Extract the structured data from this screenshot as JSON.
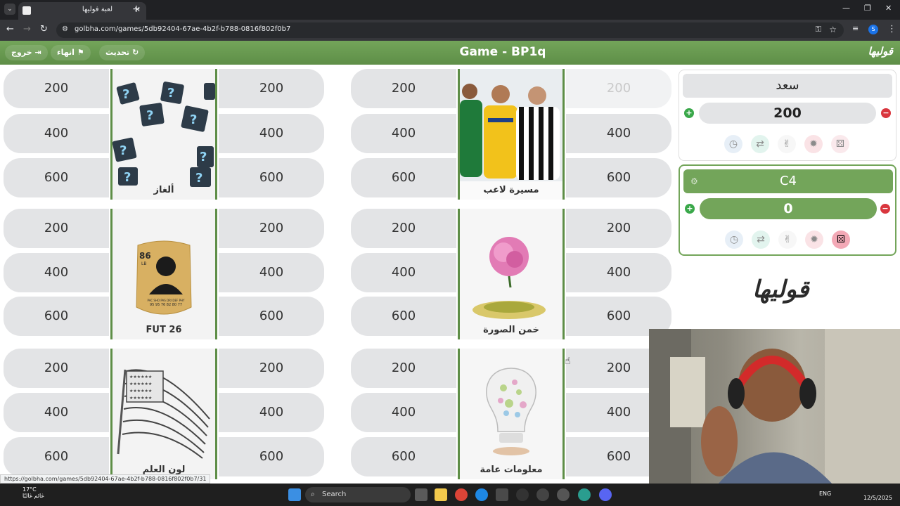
{
  "browser": {
    "tab_title": "لعبة فوليها",
    "url": "golbha.com/games/5db92404-67ae-4b2f-b788-0816f802f0b7",
    "status_url": "https://golbha.com/games/5db92404-67ae-4b2f-b788-0816f802f0b7/31",
    "profile_initial": "S"
  },
  "header": {
    "exit_label": "خروج",
    "end_label": "انهاء",
    "refresh_label": "تحديث",
    "title": "Game - BP1q",
    "logo": "قوليها"
  },
  "board": {
    "categories": [
      {
        "name": "ألغاز",
        "left": [
          "200",
          "400",
          "600"
        ],
        "right": [
          "200",
          "400",
          "600"
        ]
      },
      {
        "name": "مسيرة لاعب",
        "left": [
          "200",
          "400",
          "600"
        ],
        "right": [
          "200",
          "400",
          "600"
        ]
      },
      {
        "name": "FUT 26",
        "left": [
          "200",
          "400",
          "600"
        ],
        "right": [
          "200",
          "400",
          "600"
        ]
      },
      {
        "name": "خمن الصورة",
        "left": [
          "200",
          "400",
          "600"
        ],
        "right": [
          "200",
          "400",
          "600"
        ]
      },
      {
        "name": "لون العلم",
        "left": [
          "200",
          "400",
          "600"
        ],
        "right": [
          "200",
          "400",
          "600"
        ]
      },
      {
        "name": "معلومات عامة",
        "left": [
          "200",
          "400",
          "600"
        ],
        "right": [
          "200",
          "400",
          "600"
        ]
      }
    ],
    "fut_card": {
      "rating": "86",
      "position": "LB",
      "stats": "95 95 76 82 80 77",
      "stat_labels": "PAC SHO PAS DRI DEF PHY"
    }
  },
  "teams": [
    {
      "name": "سعد",
      "score": "200",
      "active": false
    },
    {
      "name": "C4",
      "score": "0",
      "active": true
    }
  ],
  "side_logo": "قوليها",
  "taskbar": {
    "temp": "17°C",
    "weather_label": "غائم غالبًا",
    "search_label": "Search",
    "lang": "ENG",
    "date": "12/5/2025"
  },
  "colors": {
    "brand_green": "#5e8e47",
    "cell_gray": "#e3e4e6"
  }
}
